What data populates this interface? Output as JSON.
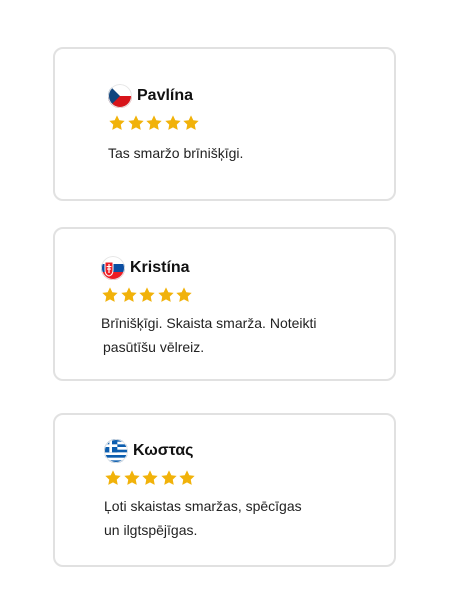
{
  "reviews": [
    {
      "name": "Pavlína",
      "flag_icon": "czech-flag-icon",
      "rating": 5,
      "text_lines": [
        "Tas smaržo brīnišķīgi."
      ]
    },
    {
      "name": "Kristína",
      "flag_icon": "slovakia-flag-icon",
      "rating": 5,
      "text_lines": [
        "Brīnišķīgi. Skaista smarža. Noteikti",
        "pasūtīšu vēlreiz."
      ]
    },
    {
      "name": "Κωστας",
      "flag_icon": "greece-flag-icon",
      "rating": 5,
      "text_lines": [
        "Ļoti skaistas smaržas, spēcīgas",
        "un ilgtspējīgas."
      ]
    }
  ],
  "colors": {
    "star": "#f1b20a",
    "border": "#e1e1e1"
  }
}
